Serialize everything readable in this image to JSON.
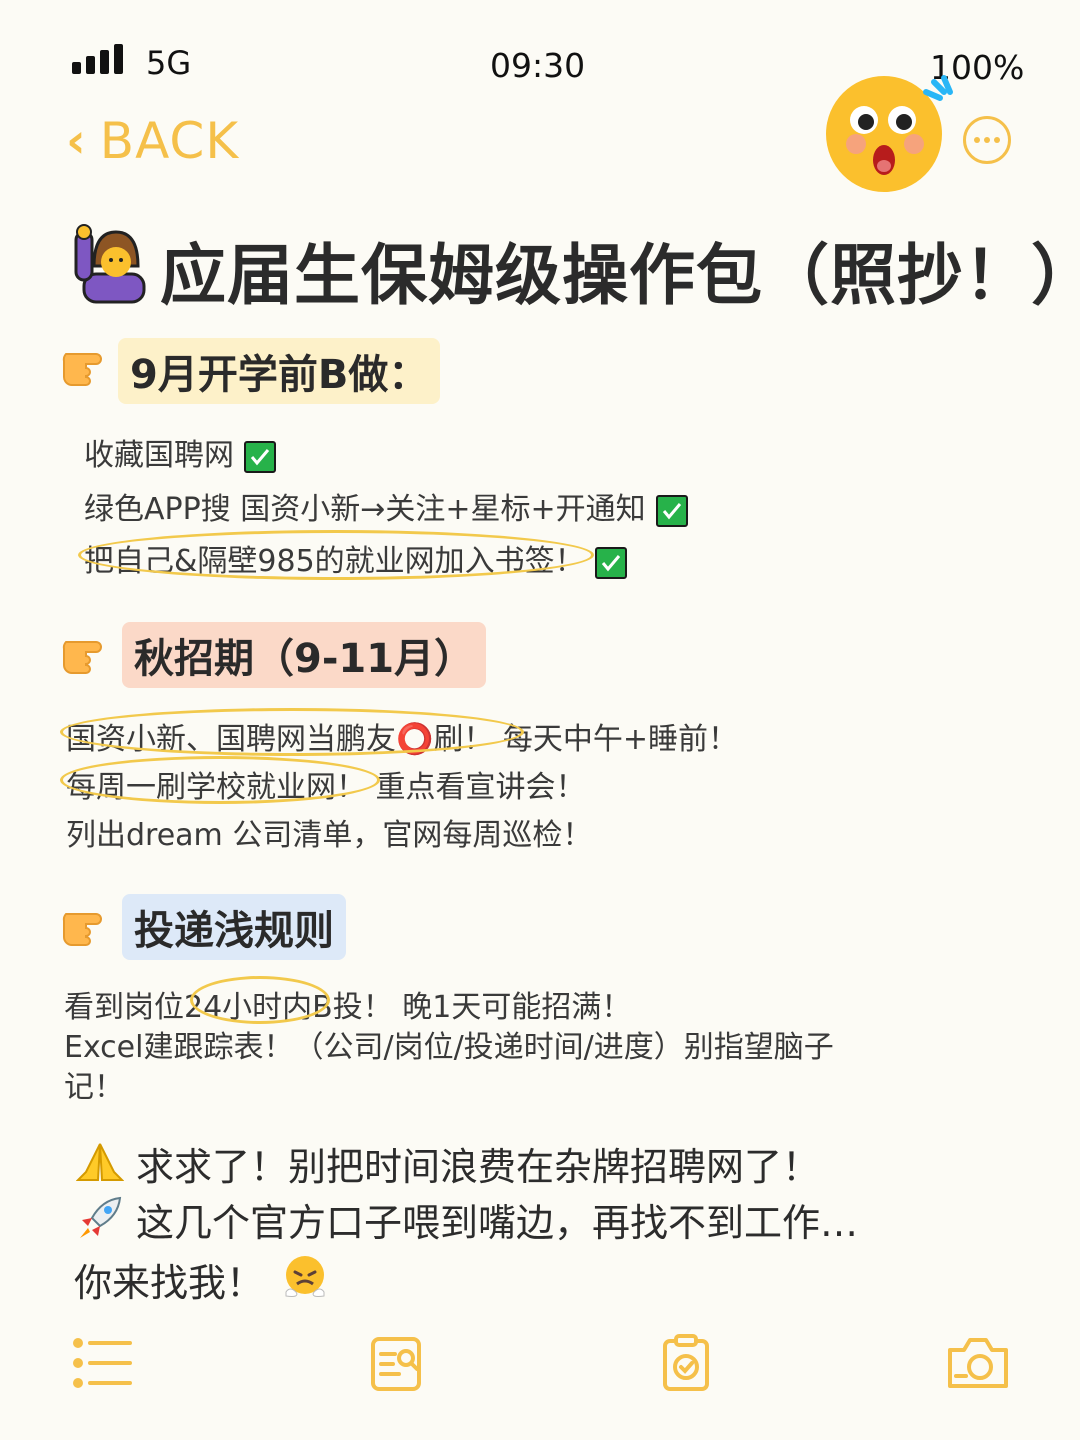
{
  "status_bar": {
    "network": "5G",
    "time": "09:30",
    "battery": "100%"
  },
  "nav": {
    "back_label": "BACK"
  },
  "title": "应届生保姆级操作包（照抄！）",
  "sections": [
    {
      "header": "9月开学前B做：",
      "color": "#fdf1c9",
      "lines": [
        "收藏国聘网",
        "绿色APP搜 国资小新→关注+星标+开通知",
        "把自己&隔壁985的就业网加入书签！"
      ]
    },
    {
      "header": "秋招期（9-11月）",
      "color": "#fbd9c8",
      "lines": [
        "国资小新、国聘网当鹏友⭕刷！ 每天中午+睡前！",
        "每周一刷学校就业网！ 重点看宣讲会！",
        "列出dream 公司清单，官网每周巡检！"
      ]
    },
    {
      "header": "投递浅规则",
      "color": "#dde9f8",
      "lines": [
        "看到岗位24小时内B投！ 晚1天可能招满！",
        "Excel建跟踪表！（公司/岗位/投递时间/进度）别指望脑子",
        "记！"
      ]
    }
  ],
  "footer": {
    "line1": "求求了！别把时间浪费在杂牌招聘网了！",
    "line2": "这几个官方口子喂到嘴边，再找不到工作…",
    "line3": "你来找我！"
  },
  "icons": [
    "signal-icon",
    "back-chevron-icon",
    "more-icon",
    "shocked-face-icon",
    "raising-hand-icon",
    "pointing-hand-icon",
    "check-icon",
    "praying-hands-icon",
    "rocket-icon",
    "steaming-face-icon",
    "list-icon",
    "search-doc-icon",
    "clipboard-check-icon",
    "camera-icon"
  ],
  "colors": {
    "accent": "#f5c04a",
    "highlight_oval": "#f2c94c",
    "check_green": "#27b24a"
  }
}
